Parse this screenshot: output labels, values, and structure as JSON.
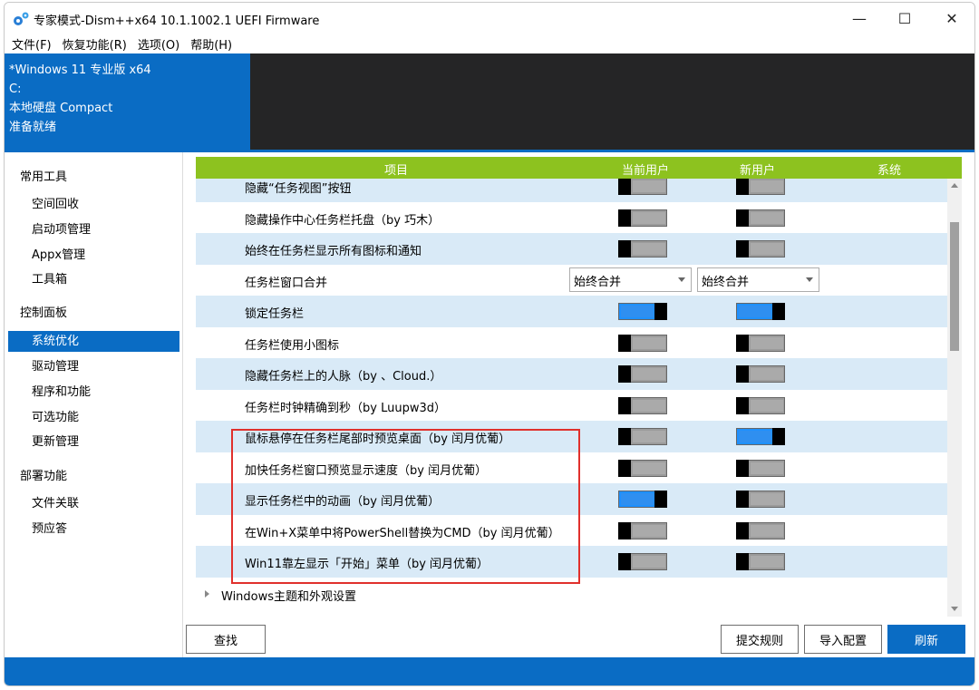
{
  "window": {
    "title": "专家模式-Dism++x64 10.1.1002.1 UEFI Firmware",
    "minimize": "—",
    "maximize": "☐",
    "close": "✕"
  },
  "menu": [
    "文件(F)",
    "恢复功能(R)",
    "选项(O)",
    "帮助(H)"
  ],
  "header": {
    "lines": [
      "*Windows 11 专业版 x64",
      "C:",
      "本地硬盘 Compact",
      "准备就绪"
    ]
  },
  "sidebar": {
    "groups": [
      {
        "label": "常用工具",
        "items": [
          "空间回收",
          "启动项管理",
          "Appx管理",
          "工具箱"
        ]
      },
      {
        "label": "控制面板",
        "items": [
          "系统优化",
          "驱动管理",
          "程序和功能",
          "可选功能",
          "更新管理"
        ]
      },
      {
        "label": "部署功能",
        "items": [
          "文件关联",
          "预应答"
        ]
      }
    ],
    "selected": "系统优化"
  },
  "table": {
    "columns": [
      "项目",
      "当前用户",
      "新用户",
      "系统"
    ],
    "rows": [
      {
        "label": "隐藏“任务视图”按钮",
        "current": "off",
        "new": "off"
      },
      {
        "label": "隐藏操作中心任务栏托盘（by 巧木）",
        "current": "off",
        "new": "off"
      },
      {
        "label": "始终在任务栏显示所有图标和通知",
        "current": "off",
        "new": "off"
      },
      {
        "label": "任务栏窗口合并",
        "current_combo": "始终合并",
        "new_combo": "始终合并"
      },
      {
        "label": "锁定任务栏",
        "current": "on",
        "new": "on"
      },
      {
        "label": "任务栏使用小图标",
        "current": "off",
        "new": "off"
      },
      {
        "label": "隐藏任务栏上的人脉（by 、Cloud.）",
        "current": "off",
        "new": "off"
      },
      {
        "label": "任务栏时钟精确到秒（by Luupw3d）",
        "current": "off",
        "new": "off"
      },
      {
        "label": "鼠标悬停在任务栏尾部时预览桌面（by 闰月优葡）",
        "current": "off",
        "new": "on"
      },
      {
        "label": "加快任务栏窗口预览显示速度（by 闰月优葡）",
        "current": "off",
        "new": "off"
      },
      {
        "label": "显示任务栏中的动画（by 闰月优葡）",
        "current": "on",
        "new": "off"
      },
      {
        "label": "在Win+X菜单中将PowerShell替换为CMD（by 闰月优葡）",
        "current": "off",
        "new": "off"
      },
      {
        "label": "Win11靠左显示「开始」菜单（by 闰月优葡）",
        "current": "off",
        "new": "off"
      }
    ],
    "group_next": "Windows主题和外观设置"
  },
  "buttons": {
    "find": "查找",
    "submit_rule": "提交规则",
    "import_config": "导入配置",
    "refresh": "刷新"
  },
  "colors": {
    "accent": "#0a6cc4",
    "header_green": "#8dc21f",
    "highlight_red": "#e0302c"
  }
}
